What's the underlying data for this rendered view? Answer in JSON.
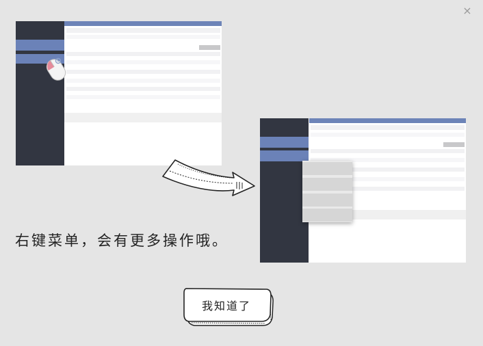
{
  "close": {
    "glyph": "×"
  },
  "hint": {
    "text": "右键菜单，会有更多操作哦。"
  },
  "confirm": {
    "label": "我知道了"
  },
  "icons": {
    "close": "close-icon",
    "mouse": "mouse-icon",
    "arrow": "curved-arrow-icon"
  },
  "colors": {
    "background": "#e5e5e5",
    "sidebar": "#323641",
    "accent": "#6d84b8",
    "menu_item": "#d6d6d6"
  }
}
